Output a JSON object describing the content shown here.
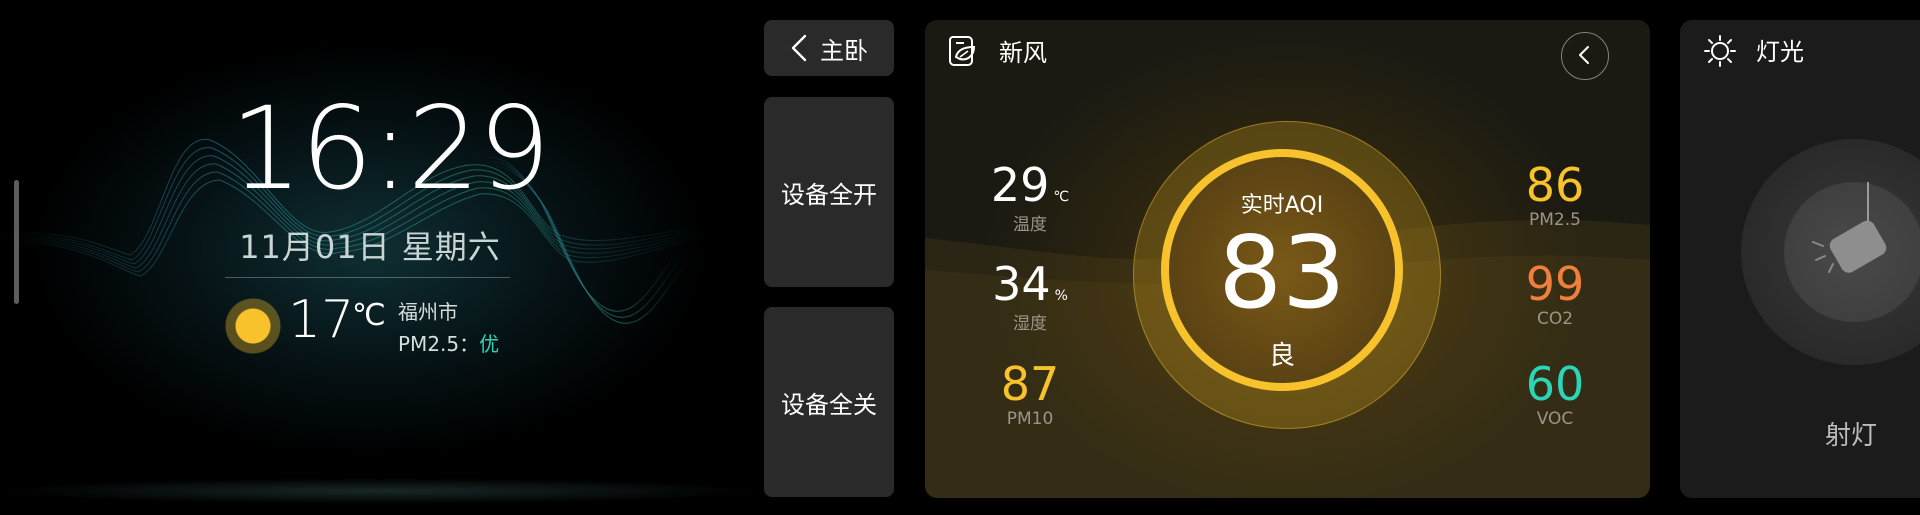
{
  "clock": {
    "time": "16:29",
    "date": "11月01日  星期六",
    "temperature": "17",
    "temperature_unit": "℃",
    "city": "福州市",
    "pm_label": "PM2.5：",
    "pm_quality": "优",
    "weather_icon": "sun-icon"
  },
  "controls": {
    "room_label": "主卧",
    "all_on_label": "设备全开",
    "all_off_label": "设备全关"
  },
  "fresh_air": {
    "title": "新风",
    "icon": "fresh-air-icon",
    "aqi_title": "实时AQI",
    "aqi_value": "83",
    "aqi_level": "良",
    "metrics_left": [
      {
        "value": "29",
        "unit": "℃",
        "label": "温度",
        "color": "#ffffff"
      },
      {
        "value": "34",
        "unit": "%",
        "label": "湿度",
        "color": "#ffffff"
      },
      {
        "value": "87",
        "unit": "",
        "label": "PM10",
        "color": "#f7c22b"
      }
    ],
    "metrics_right": [
      {
        "value": "86",
        "label": "PM2.5",
        "color": "#f7c22b"
      },
      {
        "value": "99",
        "label": "CO2",
        "color": "#f07f3c"
      },
      {
        "value": "60",
        "label": "VOC",
        "color": "#2bd6b8"
      }
    ]
  },
  "light": {
    "title": "灯光",
    "icon": "sun-outline-icon",
    "device_label": "射灯"
  },
  "colors": {
    "accent_yellow": "#f7c22b",
    "accent_orange": "#f07f3c",
    "accent_teal": "#2bd6b8"
  }
}
